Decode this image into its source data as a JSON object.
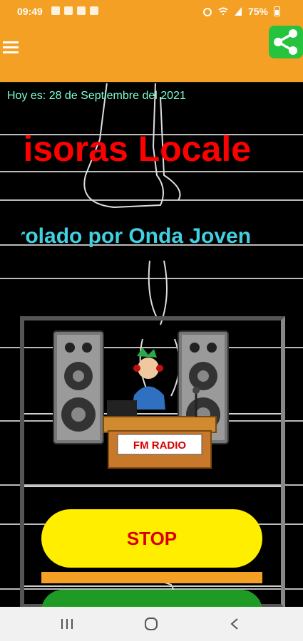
{
  "status": {
    "time": "09:49",
    "battery": "75%"
  },
  "app": {
    "date_label": "Hoy es: 28 de Septiembre del 2021"
  },
  "marquee": {
    "title": "misoras Locale",
    "subtitle": "rrolado por Onda Joven"
  },
  "player": {
    "sign": "FM RADIO",
    "stop_label": "STOP",
    "progress_fraction": 1.0
  },
  "colors": {
    "accent": "#f3a024",
    "share": "#26c33f",
    "stop_bg": "#ffee00",
    "stop_text": "#d80000",
    "title": "#ff0000",
    "subtitle": "#40d0e0",
    "date": "#7fffd4"
  },
  "icons": {
    "menu": "hamburger-icon",
    "share": "share-icon",
    "recents": "recents-icon",
    "home": "home-icon",
    "back": "back-icon"
  }
}
